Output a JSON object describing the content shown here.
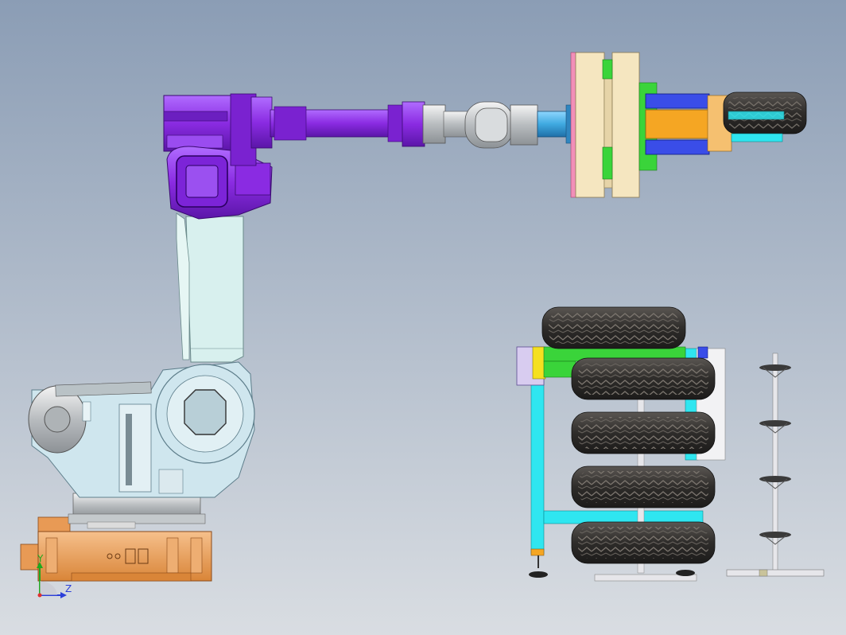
{
  "viewport": {
    "background_top": "#8b9db5",
    "background_bottom": "#d9dde2"
  },
  "colors": {
    "arm_purple": "#8a2be2",
    "arm_purple_dark": "#5b16a8",
    "link_light": "#d8f0ee",
    "base_orange": "#e89a55",
    "base_orange_dark": "#b5652a",
    "body_light_blue": "#cfe6ee",
    "flange_blue": "#3fa9e0",
    "gripper_cream": "#f5e6c0",
    "gripper_pink": "#f28fb8",
    "green_part": "#3ad43a",
    "orange_part": "#f5a623",
    "blue_part": "#3a4de8",
    "cyan_frame": "#2fe6f0",
    "tire_dark": "#2e2c2a",
    "tire_tread": "#4c4844",
    "stand_gray": "#e6e6ea"
  },
  "axis_triad": {
    "labels": [
      "Y",
      "Z"
    ],
    "y_color": "#1fa81f",
    "z_color": "#2b3fd9",
    "origin_color": "#e03030"
  },
  "icons": {
    "triad": "coordinate-triad-icon"
  }
}
